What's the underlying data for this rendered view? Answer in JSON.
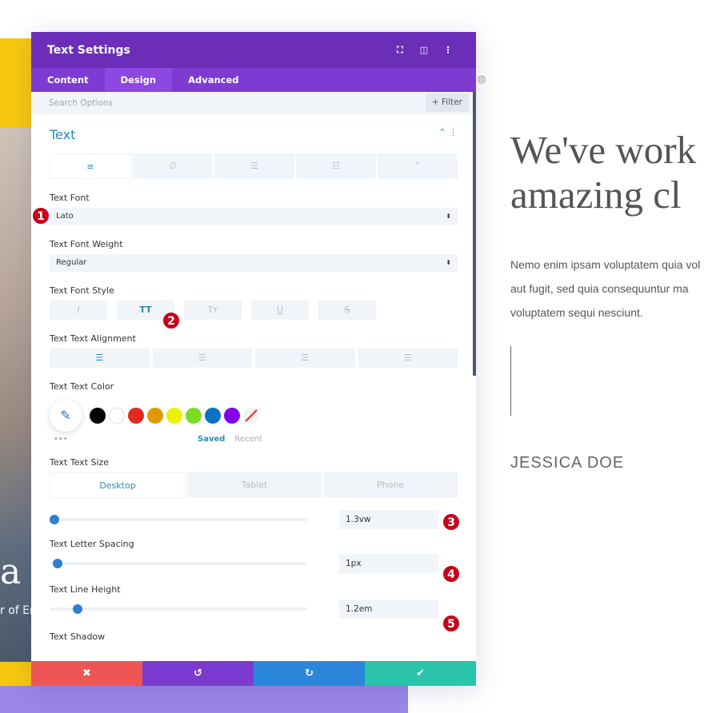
{
  "background": {
    "hero_partial_text": "a I",
    "hero_partial_subtext": "r of En",
    "headline_line1": "We've work",
    "headline_line2": "amazing cl",
    "paragraph_line1": "Nemo enim ipsam voluptatem quia vol",
    "paragraph_line2": "aut fugit, sed quia consequuntur ma",
    "paragraph_line3": "voluptatem sequi nesciunt.",
    "author_name": "JESSICA DOE"
  },
  "panel": {
    "title": "Text Settings",
    "header_icons": [
      "fullscreen-icon",
      "split-view-icon",
      "more-options-icon"
    ],
    "tabs": [
      "Content",
      "Design",
      "Advanced"
    ],
    "active_tab": "Design",
    "search_placeholder": "Search Options",
    "filter_label": "+ Filter",
    "section_title": "Text",
    "subtabs": [
      "paragraph-icon",
      "link-icon",
      "unordered-list-icon",
      "ordered-list-icon",
      "blockquote-icon"
    ],
    "text_font": {
      "label": "Text Font",
      "value": "Lato"
    },
    "font_weight": {
      "label": "Text Font Weight",
      "value": "Regular"
    },
    "font_style": {
      "label": "Text Font Style",
      "buttons": [
        "I",
        "TT",
        "Tт",
        "U",
        "S"
      ],
      "active": "TT"
    },
    "alignment": {
      "label": "Text Text Alignment",
      "options": [
        "left",
        "center",
        "right",
        "justify"
      ],
      "active": "left"
    },
    "text_color": {
      "label": "Text Text Color",
      "swatches": [
        "#000000",
        "#ffffff",
        "#e02b20",
        "#e09900",
        "#edf000",
        "#7cda24",
        "#0c71c3",
        "#8300e9"
      ],
      "saved_label": "Saved",
      "recent_label": "Recent",
      "more": "•••"
    },
    "text_size": {
      "label": "Text Text Size",
      "devices": [
        "Desktop",
        "Tablet",
        "Phone"
      ],
      "active_device": "Desktop",
      "value": "1.3vw",
      "slider_fraction": 0.02
    },
    "letter_spacing": {
      "label": "Text Letter Spacing",
      "value": "1px",
      "slider_fraction": 0.03
    },
    "line_height": {
      "label": "Text Line Height",
      "value": "1.2em",
      "slider_fraction": 0.11
    },
    "text_shadow": {
      "label": "Text Shadow"
    },
    "footer": {
      "cancel": "✖",
      "undo": "↺",
      "redo": "↻",
      "save": "✔"
    },
    "colors": {
      "header": "#6c2eb9",
      "tabs": "#7d3bd1",
      "cancel": "#ef5555",
      "undo": "#7b3bd0",
      "redo": "#2b87da",
      "save": "#29c4a9",
      "accent": "#2e8ab8"
    }
  },
  "annotations": [
    "1",
    "2",
    "3",
    "4",
    "5"
  ]
}
